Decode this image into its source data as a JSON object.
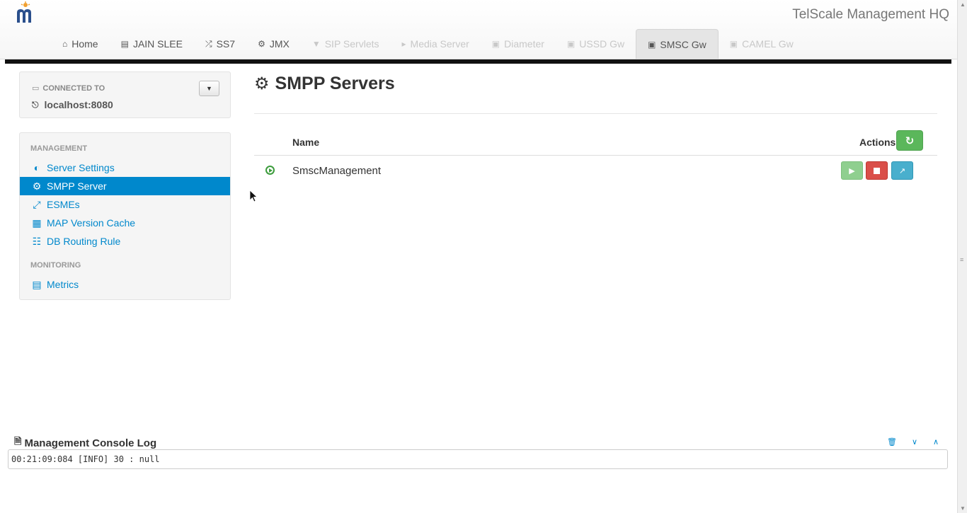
{
  "header": {
    "app_title": "TelScale Management HQ",
    "tabs": [
      {
        "label": "Home",
        "icon": "home-icon",
        "state": "enabled"
      },
      {
        "label": "JAIN SLEE",
        "icon": "server-icon",
        "state": "enabled"
      },
      {
        "label": "SS7",
        "icon": "shuffle-icon",
        "state": "enabled"
      },
      {
        "label": "JMX",
        "icon": "gear-icon",
        "state": "enabled"
      },
      {
        "label": "SIP Servlets",
        "icon": "filter-icon",
        "state": "disabled"
      },
      {
        "label": "Media Server",
        "icon": "volume-icon",
        "state": "disabled"
      },
      {
        "label": "Diameter",
        "icon": "briefcase-icon",
        "state": "disabled"
      },
      {
        "label": "USSD Gw",
        "icon": "briefcase-icon",
        "state": "disabled"
      },
      {
        "label": "SMSC Gw",
        "icon": "briefcase-icon",
        "state": "active"
      },
      {
        "label": "CAMEL Gw",
        "icon": "briefcase-icon",
        "state": "disabled"
      }
    ]
  },
  "connection": {
    "label": "CONNECTED TO",
    "host": "localhost:8080"
  },
  "sidebar": {
    "management_header": "MANAGEMENT",
    "monitoring_header": "MONITORING",
    "items": [
      {
        "label": "Server Settings",
        "icon": "dashboard-icon"
      },
      {
        "label": "SMPP Server",
        "icon": "cogs-icon",
        "active": true
      },
      {
        "label": "ESMEs",
        "icon": "compress-icon"
      },
      {
        "label": "MAP Version Cache",
        "icon": "table-icon"
      },
      {
        "label": "DB Routing Rule",
        "icon": "sitemap-icon"
      }
    ],
    "monitoring_items": [
      {
        "label": "Metrics",
        "icon": "bar-chart-icon"
      }
    ]
  },
  "main": {
    "title": "SMPP Servers",
    "table": {
      "col_name": "Name",
      "col_actions": "Actions",
      "rows": [
        {
          "name": "SmscManagement",
          "status": "running"
        }
      ]
    }
  },
  "log": {
    "title": "Management Console Log",
    "lines": [
      "00:21:09:084 [INFO] 30 : null"
    ]
  },
  "colors": {
    "accent": "#0088cc",
    "success": "#5bb75b",
    "danger": "#da4f49",
    "info": "#49afcd"
  }
}
